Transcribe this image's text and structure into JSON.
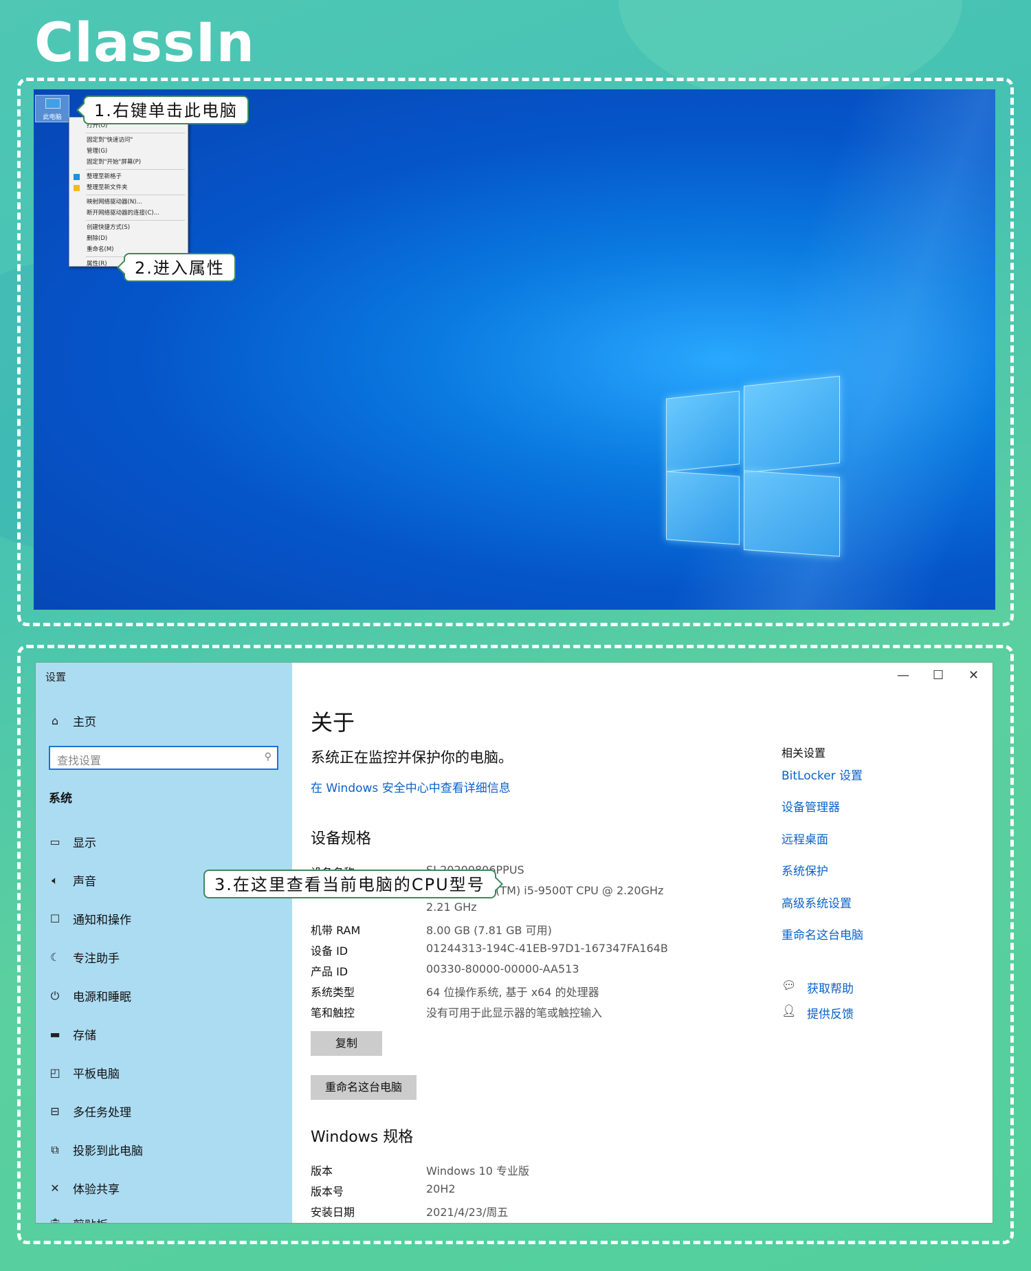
{
  "brand": {
    "logo_text": "ClassIn"
  },
  "desktop": {
    "icon_label": "此电脑",
    "context_menu": {
      "items": [
        "打开(O)",
        "固定到\"快速访问\"",
        "管理(G)",
        "固定到\"开始\"屏幕(P)",
        "整理至新格子",
        "整理至新文件夹",
        "映射网络驱动器(N)...",
        "断开网络驱动器的连接(C)...",
        "创建快捷方式(S)",
        "删除(D)",
        "重命名(M)",
        "属性(R)"
      ]
    },
    "callouts": {
      "step1": "1.右键单击此电脑",
      "step2": "2.进入属性"
    }
  },
  "settings": {
    "window_title": "设置",
    "sidebar": {
      "home": "主页",
      "search_placeholder": "查找设置",
      "section": "系统",
      "items": [
        "显示",
        "声音",
        "通知和操作",
        "专注助手",
        "电源和睡眠",
        "存储",
        "平板电脑",
        "多任务处理",
        "投影到此电脑",
        "体验共享",
        "剪贴板"
      ]
    },
    "main": {
      "title": "关于",
      "status": "系统正在监控并保护你的电脑。",
      "security_link": "在 Windows 安全中心中查看详细信息",
      "device_spec_title": "设备规格",
      "device_name_label": "设备名称",
      "device_name_value": "SJ-20200806PPUS",
      "processor_value": "Intel(R) Core(TM) i5-9500T CPU @ 2.20GHz",
      "processor_value2": "2.21 GHz",
      "ram_label": "机带 RAM",
      "ram_value": "8.00 GB (7.81 GB 可用)",
      "device_id_label": "设备 ID",
      "device_id_value": "01244313-194C-41EB-97D1-167347FA164B",
      "product_id_label": "产品 ID",
      "product_id_value": "00330-80000-00000-AA513",
      "system_type_label": "系统类型",
      "system_type_value": "64 位操作系统, 基于 x64 的处理器",
      "pen_label": "笔和触控",
      "pen_value": "没有可用于此显示器的笔或触控输入",
      "copy_button": "复制",
      "rename_button": "重命名这台电脑",
      "win_spec_title": "Windows 规格",
      "edition_label": "版本",
      "edition_value": "Windows 10 专业版",
      "version_label": "版本号",
      "version_value": "20H2",
      "install_label": "安装日期",
      "install_value": "2021/4/23/周五"
    },
    "related": {
      "title": "相关设置",
      "links": [
        "BitLocker 设置",
        "设备管理器",
        "远程桌面",
        "系统保护",
        "高级系统设置",
        "重命名这台电脑"
      ],
      "help": "获取帮助",
      "feedback": "提供反馈"
    },
    "callout3": "3.在这里查看当前电脑的CPU型号"
  }
}
